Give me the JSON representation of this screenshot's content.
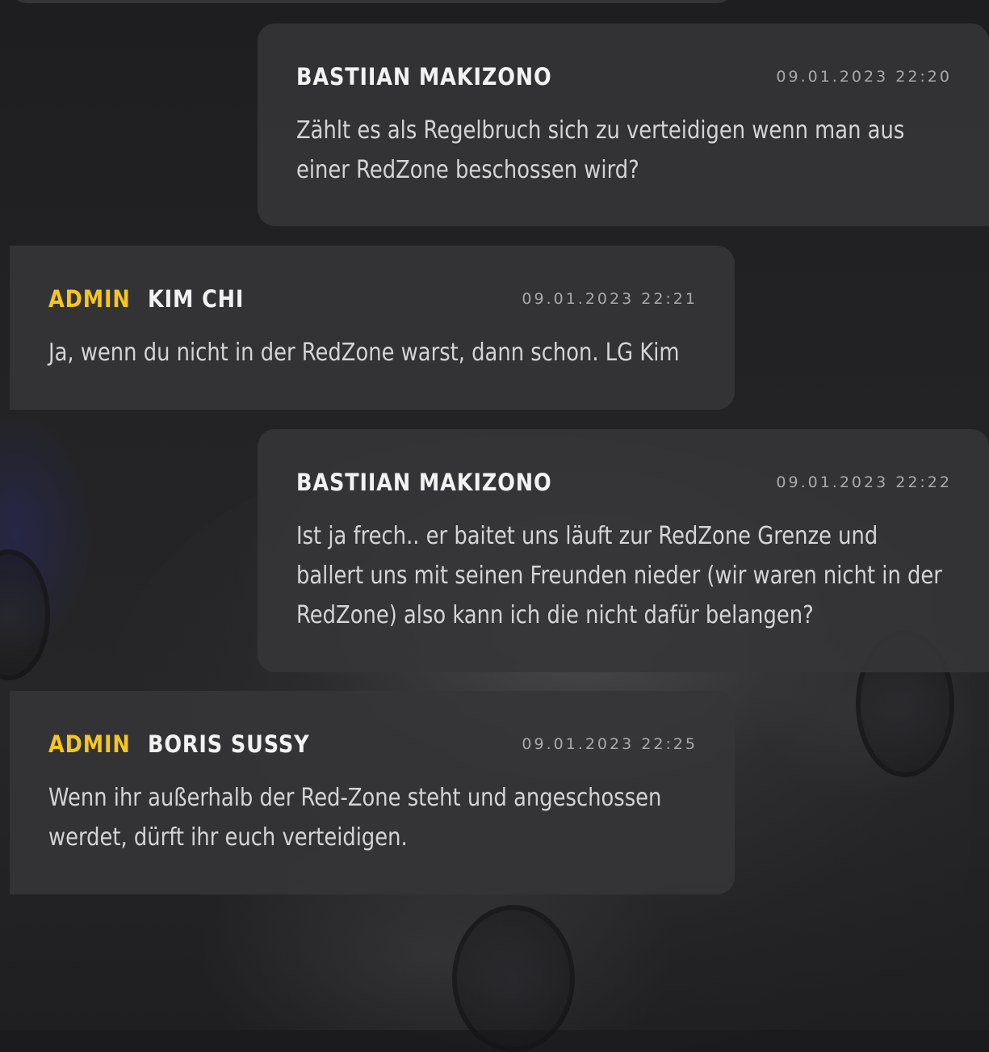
{
  "messages": [
    {
      "side": "right",
      "role": "",
      "author": "BASTIIAN MAKIZONO",
      "timestamp": "09.01.2023 22:20",
      "text": "Zählt es als Regelbruch sich zu verteidigen wenn man aus einer RedZone beschossen wird?"
    },
    {
      "side": "left",
      "role": "ADMIN",
      "author": "KIM CHI",
      "timestamp": "09.01.2023 22:21",
      "text": "Ja, wenn du nicht in der RedZone warst, dann schon. LG Kim"
    },
    {
      "side": "right",
      "role": "",
      "author": "BASTIIAN MAKIZONO",
      "timestamp": "09.01.2023 22:22",
      "text": "Ist ja frech.. er baitet uns läuft zur RedZone Grenze und ballert uns mit seinen Freunden nieder (wir waren nicht in der RedZone) also kann ich die nicht dafür belangen?"
    },
    {
      "side": "left",
      "role": "ADMIN",
      "author": "BORIS SUSSY",
      "timestamp": "09.01.2023 22:25",
      "text": "Wenn ihr außerhalb der Red-Zone steht und angeschossen werdet, dürft ihr euch verteidigen."
    }
  ],
  "colors": {
    "role_accent": "#f5c623",
    "bubble_bg": "#363638",
    "name_text": "#f2f2f2",
    "body_text": "#d4d4d6",
    "timestamp_text": "#a9a9ad"
  }
}
